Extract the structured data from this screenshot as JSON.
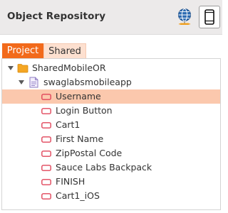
{
  "header": {
    "title": "Object Repository",
    "web_mode_icon": "globe-icon",
    "mobile_mode_icon": "mobile-phone-icon"
  },
  "tabs": [
    {
      "label": "Project",
      "active": true
    },
    {
      "label": "Shared",
      "active": false
    }
  ],
  "tree": {
    "root": {
      "label": "SharedMobileOR",
      "icon": "folder-icon",
      "expanded": true
    },
    "app": {
      "label": "swaglabsmobileapp",
      "icon": "file-icon",
      "expanded": true
    },
    "objects": [
      {
        "label": "Username",
        "selected": true
      },
      {
        "label": "Login Button",
        "selected": false
      },
      {
        "label": "Cart1",
        "selected": false
      },
      {
        "label": "First Name",
        "selected": false
      },
      {
        "label": "ZipPostal Code",
        "selected": false
      },
      {
        "label": "Sauce Labs Backpack",
        "selected": false
      },
      {
        "label": "FINISH",
        "selected": false
      },
      {
        "label": "Cart1_iOS",
        "selected": false
      }
    ]
  },
  "colors": {
    "accent": "#f26a1b",
    "selection": "#fbc8ad",
    "object_icon": "#e0455a",
    "folder": "#f5a623"
  }
}
